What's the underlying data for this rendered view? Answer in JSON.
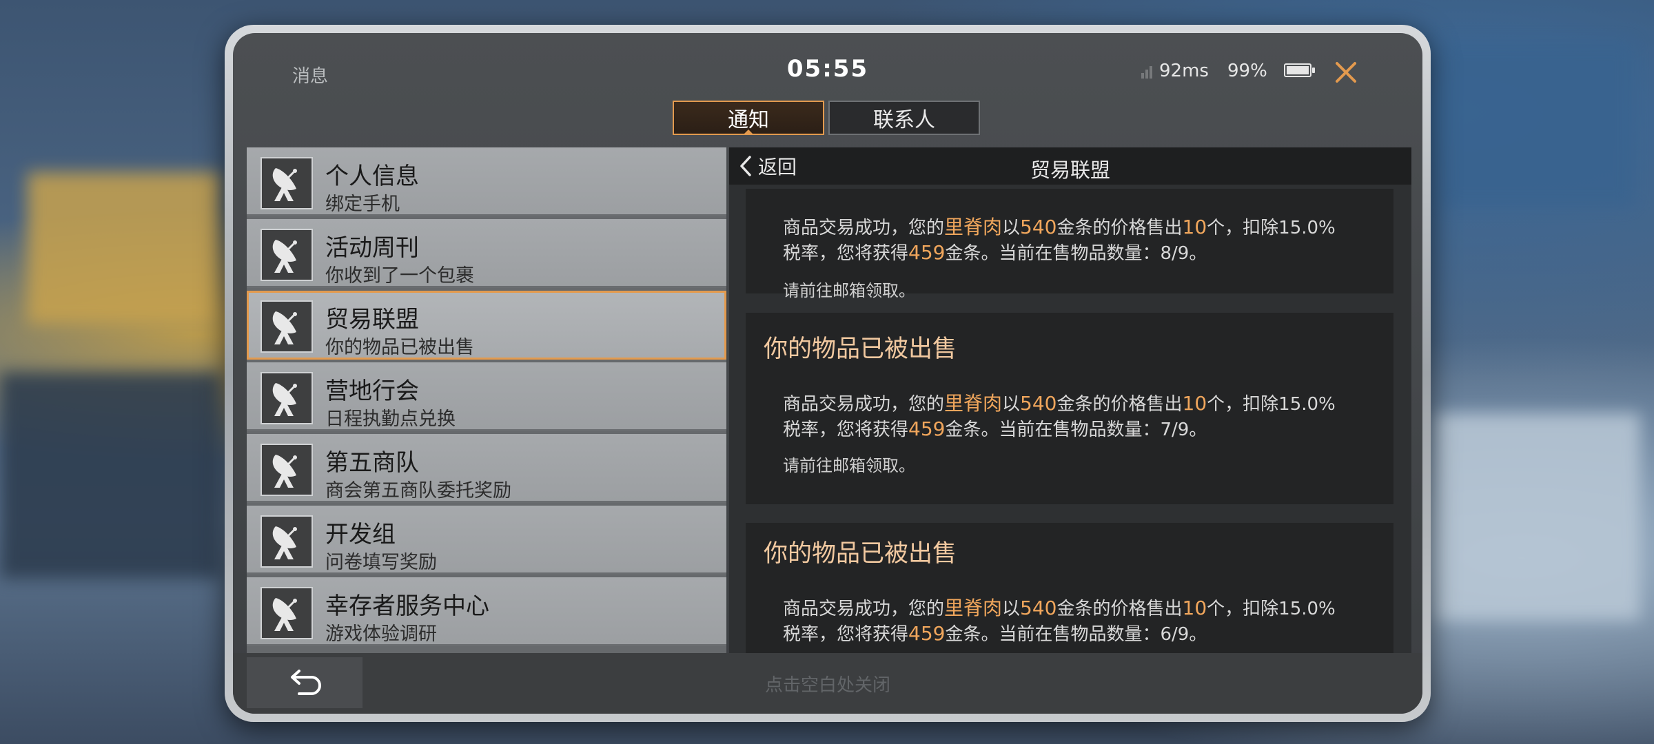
{
  "status": {
    "app_title": "消息",
    "clock": "05:55",
    "ping": "92ms",
    "battery": "99%",
    "battery_level": 0.99
  },
  "tabs": [
    {
      "label": "通知",
      "active": true
    },
    {
      "label": "联系人",
      "active": false
    }
  ],
  "list": {
    "items": [
      {
        "title": "个人信息",
        "subtitle": "绑定手机",
        "icon": "satellite-dish-icon"
      },
      {
        "title": "活动周刊",
        "subtitle": "你收到了一个包裹",
        "icon": "satellite-dish-icon"
      },
      {
        "title": "贸易联盟",
        "subtitle": "你的物品已被出售",
        "icon": "satellite-dish-icon",
        "selected": true
      },
      {
        "title": "营地行会",
        "subtitle": "日程执勤点兑换",
        "icon": "satellite-dish-icon"
      },
      {
        "title": "第五商队",
        "subtitle": "商会第五商队委托奖励",
        "icon": "satellite-dish-icon"
      },
      {
        "title": "开发组",
        "subtitle": "问卷填写奖励",
        "icon": "satellite-dish-icon"
      },
      {
        "title": "幸存者服务中心",
        "subtitle": "游戏体验调研",
        "icon": "satellite-dish-icon"
      }
    ]
  },
  "detail": {
    "back_label": "返回",
    "title": "贸易联盟",
    "messages": [
      {
        "heading": "",
        "body": {
          "p1": "商品交易成功，您的",
          "item": "里脊肉",
          "p2": "以",
          "price": "540",
          "p3": "金条的价格售出",
          "qty": "10",
          "p4": "个，扣除15.0%",
          "p5": "税率，您将获得",
          "gain": "459",
          "p6": "金条。当前在售物品数量：8/9。"
        },
        "note": "请前往邮箱领取。"
      },
      {
        "heading": "你的物品已被出售",
        "body": {
          "p1": "商品交易成功，您的",
          "item": "里脊肉",
          "p2": "以",
          "price": "540",
          "p3": "金条的价格售出",
          "qty": "10",
          "p4": "个，扣除15.0%",
          "p5": "税率，您将获得",
          "gain": "459",
          "p6": "金条。当前在售物品数量：7/9。"
        },
        "note": "请前往邮箱领取。"
      },
      {
        "heading": "你的物品已被出售",
        "body": {
          "p1": "商品交易成功，您的",
          "item": "里脊肉",
          "p2": "以",
          "price": "540",
          "p3": "金条的价格售出",
          "qty": "10",
          "p4": "个，扣除15.0%",
          "p5": "税率，您将获得",
          "gain": "459",
          "p6": "金条。当前在售物品数量：6/9。"
        },
        "note": ""
      }
    ]
  },
  "bottom": {
    "close_hint": "点击空白处关闭"
  },
  "colors": {
    "accent": "#e39a4e",
    "highlight": "#f0a65c"
  }
}
